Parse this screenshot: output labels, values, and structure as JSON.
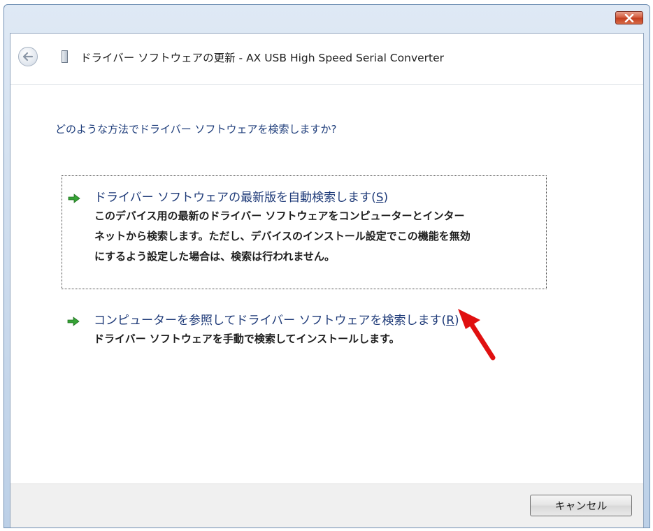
{
  "window": {
    "title": "ドライバー ソフトウェアの更新 - AX USB High Speed Serial Converter",
    "close_icon": "close-icon",
    "back_icon": "back-arrow-icon"
  },
  "main": {
    "question": "どのような方法でドライバー ソフトウェアを検索しますか?",
    "options": [
      {
        "title": "ドライバー ソフトウェアの最新版を自動検索します(",
        "accel": "S",
        "title_end": ")",
        "desc": [
          "このデバイス用の最新のドライバー ソフトウェアをコンピューターとインター",
          "ネットから検索します。ただし、デバイスのインストール設定でこの機能を無効",
          "にするよう設定した場合は、検索は行われません。"
        ],
        "icon": "green-arrow-icon"
      },
      {
        "title": "コンピューターを参照してドライバー ソフトウェアを検索します(",
        "accel": "R",
        "title_end": ")",
        "desc": [
          "ドライバー ソフトウェアを手動で検索してインストールします。"
        ],
        "icon": "green-arrow-icon"
      }
    ]
  },
  "footer": {
    "cancel_label": "キャンセル"
  },
  "colors": {
    "link_blue": "#1e3a78",
    "annotation_red": "#e01010",
    "arrow_green": "#2e9a2e"
  }
}
